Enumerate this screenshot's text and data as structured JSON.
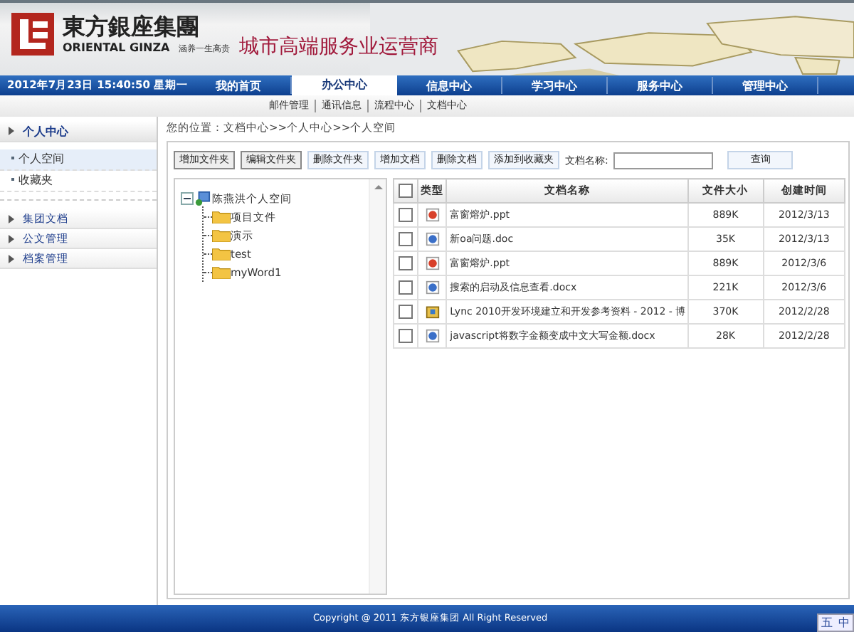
{
  "logo": {
    "name": "東方銀座集團",
    "name_en": "ORIENTAL GINZA",
    "motto": "涵养一生高贵"
  },
  "slogan": "城市高端服务业运营商",
  "datetime": "2012年7月23日  15:40:50  星期一",
  "nav": [
    {
      "label": "我的首页",
      "selected": false
    },
    {
      "label": "办公中心",
      "selected": true
    },
    {
      "label": "信息中心",
      "selected": false
    },
    {
      "label": "学习中心",
      "selected": false
    },
    {
      "label": "服务中心",
      "selected": false
    },
    {
      "label": "管理中心",
      "selected": false
    }
  ],
  "subnav": [
    "邮件管理",
    "通讯信息",
    "流程中心",
    "文档中心"
  ],
  "sidebar": {
    "title": "个人中心",
    "items": [
      {
        "label": "个人空间",
        "selected": true
      },
      {
        "label": "收藏夹",
        "selected": false
      }
    ],
    "sections": [
      "集团文档",
      "公文管理",
      "档案管理"
    ]
  },
  "breadcrumb": "您的位置：文档中心>>个人中心>>个人空间",
  "toolbar": [
    "增加文件夹",
    "编辑文件夹",
    "删除文件夹",
    "增加文档",
    "删除文档",
    "添加到收藏夹"
  ],
  "search": {
    "label": "文档名称:",
    "button": "查询"
  },
  "tree": {
    "label": "陈燕洪个人空间",
    "expanded": true,
    "children": [
      {
        "label": "项目文件"
      },
      {
        "label": "演示"
      },
      {
        "label": "test"
      },
      {
        "label": "myWord1"
      }
    ]
  },
  "table": {
    "all_checked": false,
    "columns": [
      "类型",
      "文档名称",
      "文件大小",
      "创建时间"
    ],
    "rows": [
      {
        "kind": "ppt",
        "name": "富窗熔炉.ppt",
        "size": "889K",
        "date": "2012/3/13",
        "checked": false
      },
      {
        "kind": "doc",
        "name": "新oa问题.doc",
        "size": "35K",
        "date": "2012/3/13",
        "checked": false
      },
      {
        "kind": "ppt",
        "name": "富窗熔炉.ppt",
        "size": "889K",
        "date": "2012/3/6",
        "checked": false
      },
      {
        "kind": "doc",
        "name": "搜索的启动及信息查看.docx",
        "size": "221K",
        "date": "2012/3/6",
        "checked": false
      },
      {
        "kind": "package",
        "name": "Lync 2010开发环境建立和开发参考资料 - 2012 - 博",
        "size": "370K",
        "date": "2012/2/28",
        "checked": false
      },
      {
        "kind": "doc",
        "name": "javascript将数字金额变成中文大写金额.docx",
        "size": "28K",
        "date": "2012/2/28",
        "checked": false
      }
    ]
  },
  "footer": "Copyright @ 2011 东方银座集团 All Right Reserved",
  "ime": [
    "五",
    "中"
  ]
}
